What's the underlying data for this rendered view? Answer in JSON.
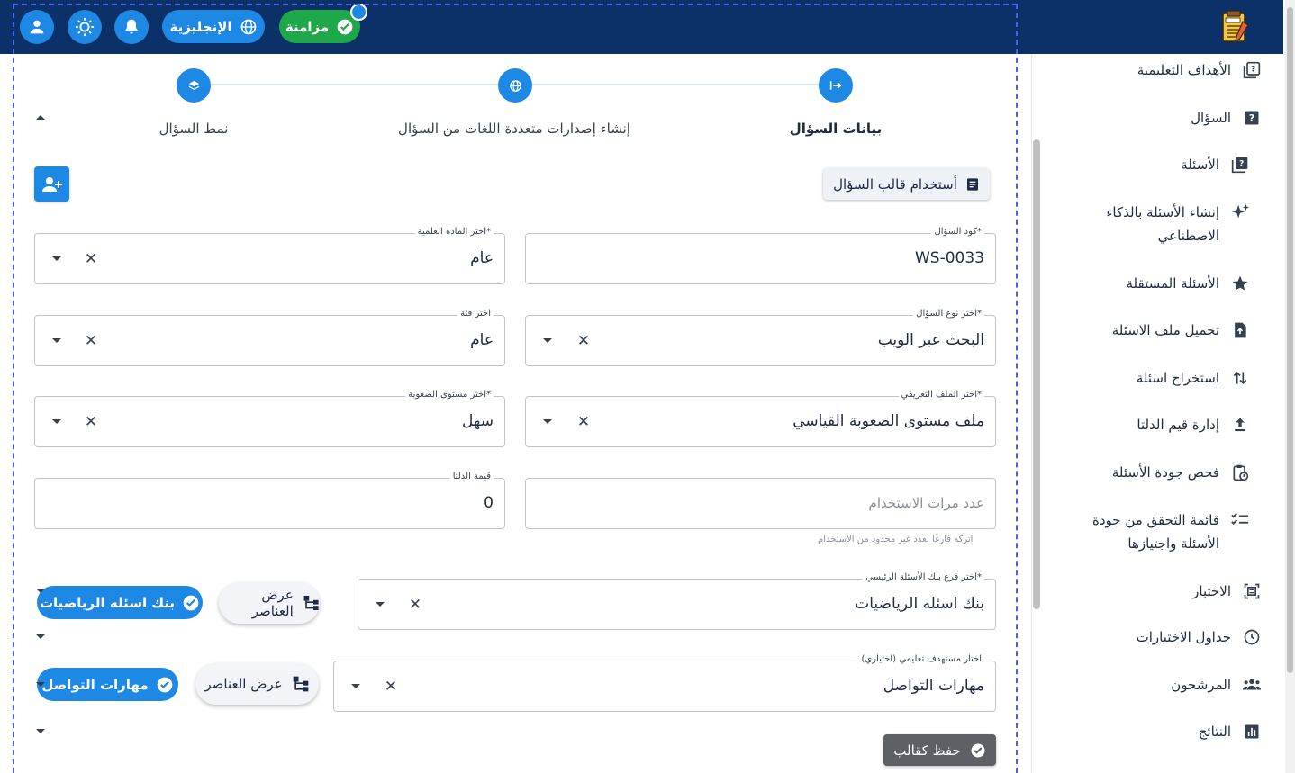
{
  "header": {
    "language_label": "الإنجليزية",
    "sync_label": "مزامنة",
    "icons": [
      "user-icon",
      "brightness-icon",
      "bell-icon",
      "globe-icon",
      "check-circle-icon",
      "exam-logo"
    ]
  },
  "stepper": {
    "steps": [
      {
        "label": "بيانات السؤال",
        "active": true
      },
      {
        "label": "إنشاء إصدارات متعددة اللغات من السؤال",
        "active": false
      },
      {
        "label": "نمط السؤال",
        "active": false
      }
    ]
  },
  "actions": {
    "use_template_label": "أستخدام قالب السؤال",
    "save_template_label": "حفظ كقالب"
  },
  "form": {
    "question_code": {
      "label": "كود السؤال*",
      "value": "WS-0033"
    },
    "subject": {
      "label": "اختر المادة العلمية*",
      "value": "عام"
    },
    "question_type": {
      "label": "اختر نوع السؤال*",
      "value": "البحث عبر الويب"
    },
    "category": {
      "label": "اختر فئة",
      "value": "عام"
    },
    "profile": {
      "label": "اختر الملف التعريفي*",
      "value": "ملف مستوى الصعوبة القياسي"
    },
    "difficulty": {
      "label": "اختر مستوى الصعوبة*",
      "value": "سهل"
    },
    "usage_count": {
      "placeholder": "عدد مرات الاستخدام",
      "hint": "اتركه فارغًا لعدد غير محدود من الاستخدام"
    },
    "delta": {
      "label": "قيمة الدلتا",
      "value": "0"
    },
    "bank_branch": {
      "label": "اختر فرع بنك الأسئلة الرئيسي*",
      "value": "بنك اسئله الرياضيات"
    },
    "target": {
      "label": "اختار مستهدف تعليمي (اختياري)",
      "value": "مهارات التواصل"
    },
    "view_items_label": "عرض العناصر",
    "chips": [
      "بنك اسئله الرياضيات",
      "مهارات التواصل"
    ]
  },
  "sidebar": {
    "items": [
      {
        "label": "الأهداف التعليمية",
        "icon": "help-box-outline-icon"
      },
      {
        "label": "السؤال",
        "icon": "help-box-icon"
      },
      {
        "label": "الأسئلة",
        "icon": "help-stack-icon"
      },
      {
        "label": "إنشاء الأسئلة بالذكاء الاصطناعي",
        "icon": "sparkles-icon"
      },
      {
        "label": "الأسئلة المستقلة",
        "icon": "star-icon"
      },
      {
        "label": "تحميل ملف الاسئلة",
        "icon": "file-upload-icon"
      },
      {
        "label": "استخراج اسئلة",
        "icon": "swap-vertical-icon"
      },
      {
        "label": "إدارة قيم الدلتا",
        "icon": "upload-icon"
      },
      {
        "label": "فحص جودة الأسئلة",
        "icon": "clipboard-check-icon"
      },
      {
        "label": "قائمة التحقق من جودة الأسئلة واجتيازها",
        "icon": "checklist-icon"
      },
      {
        "label": "الاختبار",
        "icon": "exam-frame-icon"
      },
      {
        "label": "جداول الاختبارات",
        "icon": "clock-icon"
      },
      {
        "label": "المرشحون",
        "icon": "people-icon"
      },
      {
        "label": "النتائج",
        "icon": "bar-chart-icon"
      }
    ]
  },
  "colors": {
    "header": "#0b3168",
    "accent": "#1e88e5",
    "sync": "#1ea84a",
    "save": "#5d6166"
  }
}
